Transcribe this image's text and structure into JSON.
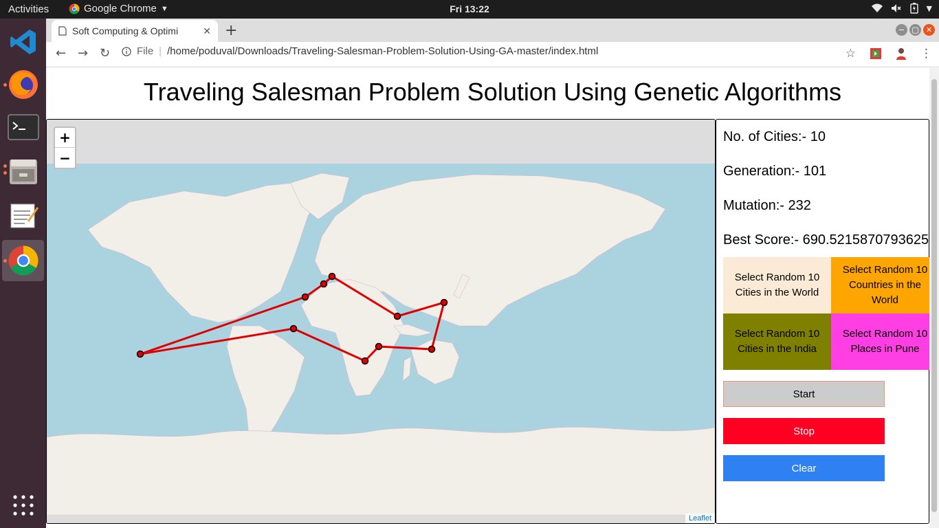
{
  "os": {
    "activities": "Activities",
    "app_menu": "Google Chrome",
    "clock": "Fri 13:22"
  },
  "browser": {
    "tab_title": "Soft Computing & Optimi",
    "url_scheme": "File",
    "url": "/home/poduval/Downloads/Traveling-Salesman-Problem-Solution-Using-GA-master/index.html"
  },
  "page": {
    "title": "Traveling Salesman Problem Solution Using Genetic Algorithms",
    "map": {
      "zoom_in": "+",
      "zoom_out": "−",
      "attribution": "Leaflet"
    },
    "stats": {
      "cities": "No. of Cities:- 10",
      "generation": "Generation:- 101",
      "mutation": "Mutation:- 232",
      "best_score": "Best Score:- 690.5215870793625"
    },
    "options": [
      {
        "label": "Select Random 10 Cities in the World",
        "color": "#fbead6"
      },
      {
        "label": "Select Random 10 Countries in the World",
        "color": "#ffa500"
      },
      {
        "label": "Select Random 10 Cities in the India",
        "color": "#808000"
      },
      {
        "label": "Select Random 10 Places in Pune",
        "color": "#ff3fe3"
      }
    ],
    "actions": {
      "start": "Start",
      "stop": "Stop",
      "clear": "Clear"
    },
    "colors": {
      "start_bg": "#cccccc",
      "stop_bg": "#ff0022",
      "clear_bg": "#2f80f0",
      "route": "#e00000",
      "ocean": "#aad3df",
      "land": "#f2efe9"
    }
  }
}
